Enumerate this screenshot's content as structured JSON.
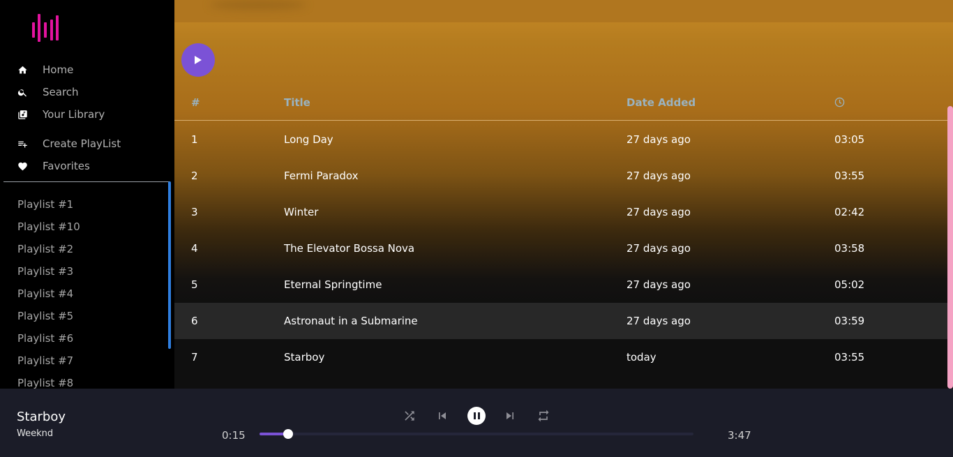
{
  "sidebar": {
    "brand_color": "#e3139e",
    "nav": [
      {
        "label": "Home",
        "icon": "home-icon"
      },
      {
        "label": "Search",
        "icon": "search-icon"
      },
      {
        "label": "Your Library",
        "icon": "library-icon"
      }
    ],
    "actions": [
      {
        "label": "Create PlayList",
        "icon": "playlist-add-icon"
      },
      {
        "label": "Favorites",
        "icon": "heart-icon"
      }
    ],
    "playlists": [
      "Playlist #1",
      "Playlist #10",
      "Playlist #2",
      "Playlist #3",
      "Playlist #4",
      "Playlist #5",
      "Playlist #6",
      "Playlist #7",
      "Playlist #8"
    ]
  },
  "table": {
    "headers": {
      "num": "#",
      "title": "Title",
      "date": "Date Added",
      "duration_icon": "clock-icon"
    },
    "rows": [
      {
        "num": "1",
        "title": "Long Day",
        "date": "27 days ago",
        "duration": "03:05"
      },
      {
        "num": "2",
        "title": "Fermi Paradox",
        "date": "27 days ago",
        "duration": "03:55"
      },
      {
        "num": "3",
        "title": "Winter",
        "date": "27 days ago",
        "duration": "02:42"
      },
      {
        "num": "4",
        "title": "The Elevator Bossa Nova",
        "date": "27 days ago",
        "duration": "03:58"
      },
      {
        "num": "5",
        "title": "Eternal Springtime",
        "date": "27 days ago",
        "duration": "05:02"
      },
      {
        "num": "6",
        "title": "Astronaut in a Submarine",
        "date": "27 days ago",
        "duration": "03:59"
      },
      {
        "num": "7",
        "title": "Starboy",
        "date": "today",
        "duration": "03:55"
      }
    ],
    "highlighted_row": 6
  },
  "player": {
    "title": "Starboy",
    "artist": "Weeknd",
    "current_time": "0:15",
    "total_time": "3:47",
    "progress": 0.066,
    "accent": "#7b52d6",
    "state": "playing"
  }
}
